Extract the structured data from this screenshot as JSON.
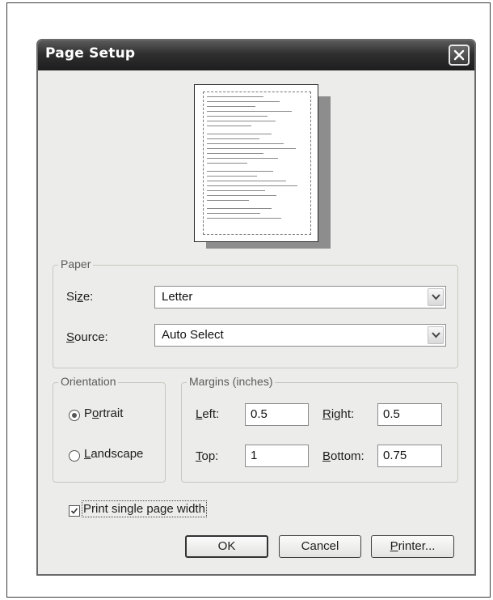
{
  "dialog": {
    "title": "Page Setup"
  },
  "icons": {
    "close": "close-icon",
    "dropdown": "chevron-down-icon",
    "check": "checkmark-icon"
  },
  "paper": {
    "group_label": "Paper",
    "size_label_pre": "Si",
    "size_label_key": "z",
    "size_label_post": "e:",
    "size_value": "Letter",
    "source_label_key": "S",
    "source_label_post": "ource:",
    "source_value": "Auto Select"
  },
  "orientation": {
    "group_label": "Orientation",
    "portrait_pre": "P",
    "portrait_key": "o",
    "portrait_post": "rtrait",
    "portrait_selected": true,
    "landscape_key": "L",
    "landscape_post": "andscape",
    "landscape_selected": false
  },
  "margins": {
    "group_label": "Margins (inches)",
    "left_key": "L",
    "left_post": "eft:",
    "left_value": "0.5",
    "right_key": "R",
    "right_post": "ight:",
    "right_value": "0.5",
    "top_key": "T",
    "top_post": "op:",
    "top_value": "1",
    "bottom_key": "B",
    "bottom_post": "ottom:",
    "bottom_value": "0.75"
  },
  "print_single_page": {
    "label": "Print single page width",
    "checked": true
  },
  "buttons": {
    "ok": "OK",
    "cancel": "Cancel",
    "printer_key": "P",
    "printer_post": "rinter..."
  }
}
